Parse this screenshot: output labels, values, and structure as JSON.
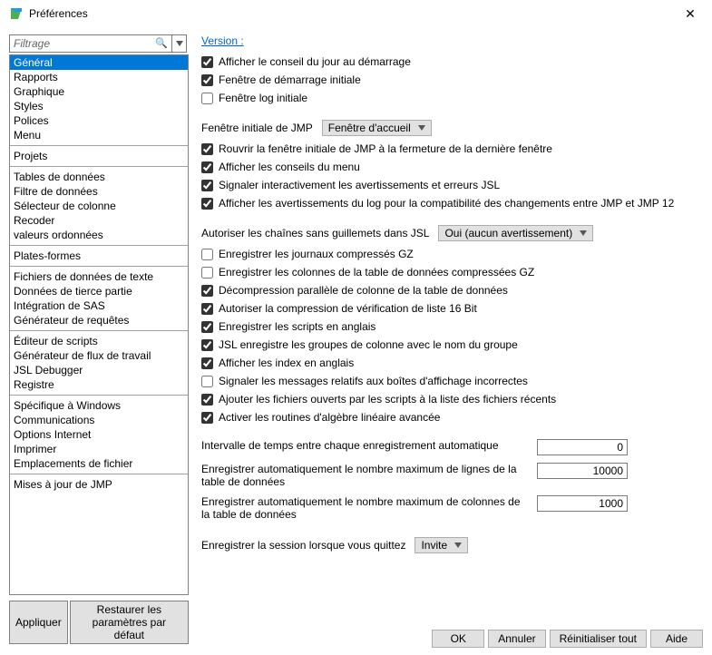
{
  "window": {
    "title": "Préférences",
    "close": "✕"
  },
  "filter": {
    "placeholder": "Filtrage"
  },
  "categories": {
    "groups": [
      [
        "Général",
        "Rapports",
        "Graphique",
        "Styles",
        "Polices",
        "Menu"
      ],
      [
        "Projets"
      ],
      [
        "Tables de données",
        "Filtre de données",
        "Sélecteur de colonne",
        "Recoder",
        "valeurs ordonnées"
      ],
      [
        "Plates-formes"
      ],
      [
        "Fichiers de données de texte",
        "Données de tierce partie",
        "Intégration de SAS",
        "Générateur de requêtes"
      ],
      [
        "Éditeur de scripts",
        "Générateur de flux de travail",
        "JSL Debugger",
        "Registre"
      ],
      [
        "Spécifique à Windows",
        "Communications",
        "Options Internet",
        "Imprimer",
        "Emplacements de fichier"
      ],
      [
        "Mises à jour de JMP"
      ]
    ],
    "selected": "Général"
  },
  "buttons": {
    "apply": "Appliquer",
    "restore": "Restaurer les paramètres par défaut",
    "ok": "OK",
    "cancel": "Annuler",
    "resetall": "Réinitialiser tout",
    "help": "Aide"
  },
  "main": {
    "version": "Version :",
    "cb1": {
      "checked": true,
      "label": "Afficher le conseil du jour au démarrage"
    },
    "cb2": {
      "checked": true,
      "label": "Fenêtre de démarrage initiale"
    },
    "cb3": {
      "checked": false,
      "label": "Fenêtre log initiale"
    },
    "initwin": {
      "label": "Fenêtre initiale de JMP",
      "value": "Fenêtre d'accueil"
    },
    "cb4": {
      "checked": true,
      "label": "Rouvrir la fenêtre initiale de JMP à la fermeture de la dernière fenêtre"
    },
    "cb5": {
      "checked": true,
      "label": "Afficher les conseils du menu"
    },
    "cb6": {
      "checked": true,
      "label": "Signaler interactivement les avertissements et erreurs JSL"
    },
    "cb7": {
      "checked": true,
      "label": "Afficher les avertissements du log pour la compatibilité des changements entre JMP et JMP 12"
    },
    "unquoted": {
      "label": "Autoriser les chaînes sans guillemets dans JSL",
      "value": "Oui (aucun avertissement)"
    },
    "cb8": {
      "checked": false,
      "label": "Enregistrer les journaux compressés GZ"
    },
    "cb9": {
      "checked": false,
      "label": "Enregistrer les colonnes de la table de données compressées GZ"
    },
    "cb10": {
      "checked": true,
      "label": "Décompression parallèle de colonne de la table de données"
    },
    "cb11": {
      "checked": true,
      "label": "Autoriser la compression de vérification de liste 16 Bit"
    },
    "cb12": {
      "checked": true,
      "label": "Enregistrer les scripts en anglais"
    },
    "cb13": {
      "checked": true,
      "label": "JSL enregistre les groupes de colonne avec le nom du groupe"
    },
    "cb14": {
      "checked": true,
      "label": "Afficher les index en anglais"
    },
    "cb15": {
      "checked": false,
      "label": "Signaler les messages relatifs aux boîtes d'affichage incorrectes"
    },
    "cb16": {
      "checked": true,
      "label": "Ajouter les fichiers ouverts par les scripts à la liste des fichiers récents"
    },
    "cb17": {
      "checked": true,
      "label": "Activer les routines d'algèbre linéaire avancée"
    },
    "num1": {
      "label": "Intervalle de temps entre chaque enregistrement automatique",
      "value": "0"
    },
    "num2": {
      "label": "Enregistrer automatiquement le nombre maximum de lignes de la table de données",
      "value": "10000"
    },
    "num3": {
      "label": "Enregistrer automatiquement le nombre maximum de colonnes de la table de données",
      "value": "1000"
    },
    "sess": {
      "label": "Enregistrer la session lorsque vous quittez",
      "value": "Invite"
    }
  }
}
